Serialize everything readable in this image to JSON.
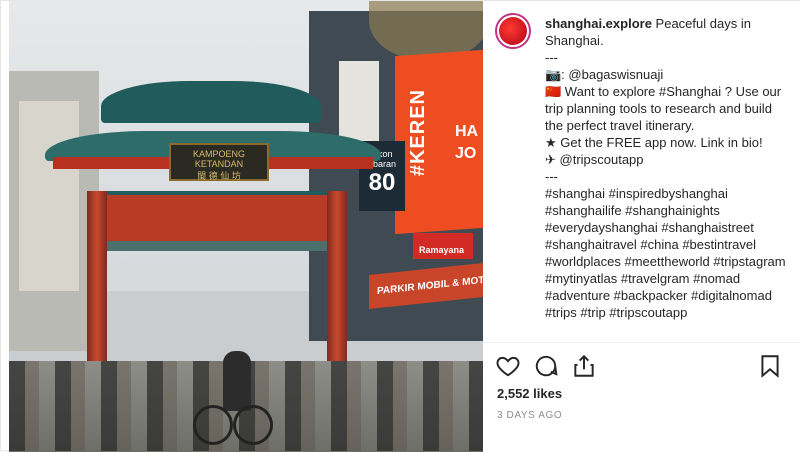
{
  "post": {
    "photo_signs": {
      "gate_plaque_latin": "KAMPOENG KETANDAN",
      "gate_plaque_chinese": "閩 德 仙 坊",
      "store_vertical": "#KEREN",
      "store_brand": "HA JO",
      "sale_small": "iskon ebaran",
      "sale_big": "80",
      "ramayana": "Ramayana",
      "banner": "PARKIR MOBIL & MOTOR"
    },
    "header": {
      "username": "shanghai.explore"
    },
    "caption": {
      "lines": [
        "Peaceful days in Shanghai.",
        "---",
        "📷: @bagaswisnuaji",
        "🇨🇳 Want to explore #Shanghai ? Use our trip planning tools to research and build the perfect travel itinerary.",
        "★ Get the FREE app now. Link in bio!",
        "✈ @tripscoutapp",
        "---",
        "#shanghai #inspiredbyshanghai #shanghailife #shanghainights #everydayshanghai #shanghaistreet #shanghaitravel #china #bestintravel #worldplaces #meettheworld #tripstagram #mytinyatlas #travelgram #nomad #adventure #backpacker #digitalnomad #trips #trip #tripscoutapp"
      ]
    },
    "actions": {
      "like_icon": "heart-icon",
      "comment_icon": "comment-icon",
      "share_icon": "share-icon",
      "save_icon": "bookmark-icon"
    },
    "likes_text": "2,552 likes",
    "timestamp": "3 DAYS AGO"
  },
  "colors": {
    "accent_red": "#ee4d21",
    "avatar_ring": "#c13584"
  }
}
